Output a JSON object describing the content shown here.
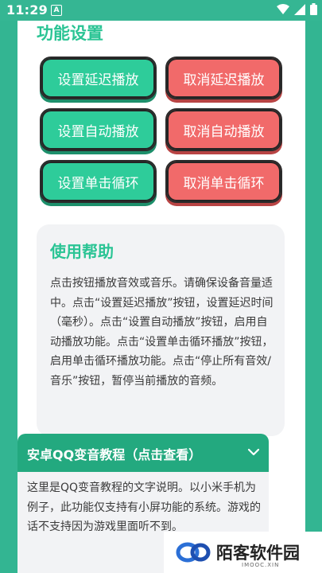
{
  "status": {
    "time": "11:29",
    "notif_letter": "A"
  },
  "function_settings": {
    "title": "功能设置",
    "buttons": [
      {
        "label": "设置延迟播放",
        "style": "green"
      },
      {
        "label": "取消延迟播放",
        "style": "red"
      },
      {
        "label": "设置自动播放",
        "style": "green"
      },
      {
        "label": "取消自动播放",
        "style": "red"
      },
      {
        "label": "设置单击循环",
        "style": "green"
      },
      {
        "label": "取消单击循环",
        "style": "red"
      }
    ]
  },
  "help": {
    "title": "使用帮助",
    "text": "点击按钮播放音效或音乐。请确保设备音量适中。点击“设置延迟播放”按钮，设置延迟时间（毫秒）。点击“设置自动播放”按钮，启用自动播放功能。点击“设置单击循环播放”按钮，启用单击循环播放功能。点击“停止所有音效/音乐”按钮，暂停当前播放的音频。"
  },
  "tutorial": {
    "title": "安卓QQ变音教程（点击查看）",
    "text": "这里是QQ变音教程的文字说明。以小米手机为例子，此功能仅支持有小屏功能的系统。游戏的话不支持因为游戏里面听不到。"
  },
  "watermark": {
    "name": "陌客软件园",
    "domain": "IMOOC.XIN"
  },
  "colors": {
    "accent": "#2ac494",
    "green_btn": "#2ecc9a",
    "red_btn": "#f16a6a",
    "header_green": "#23a97f"
  }
}
